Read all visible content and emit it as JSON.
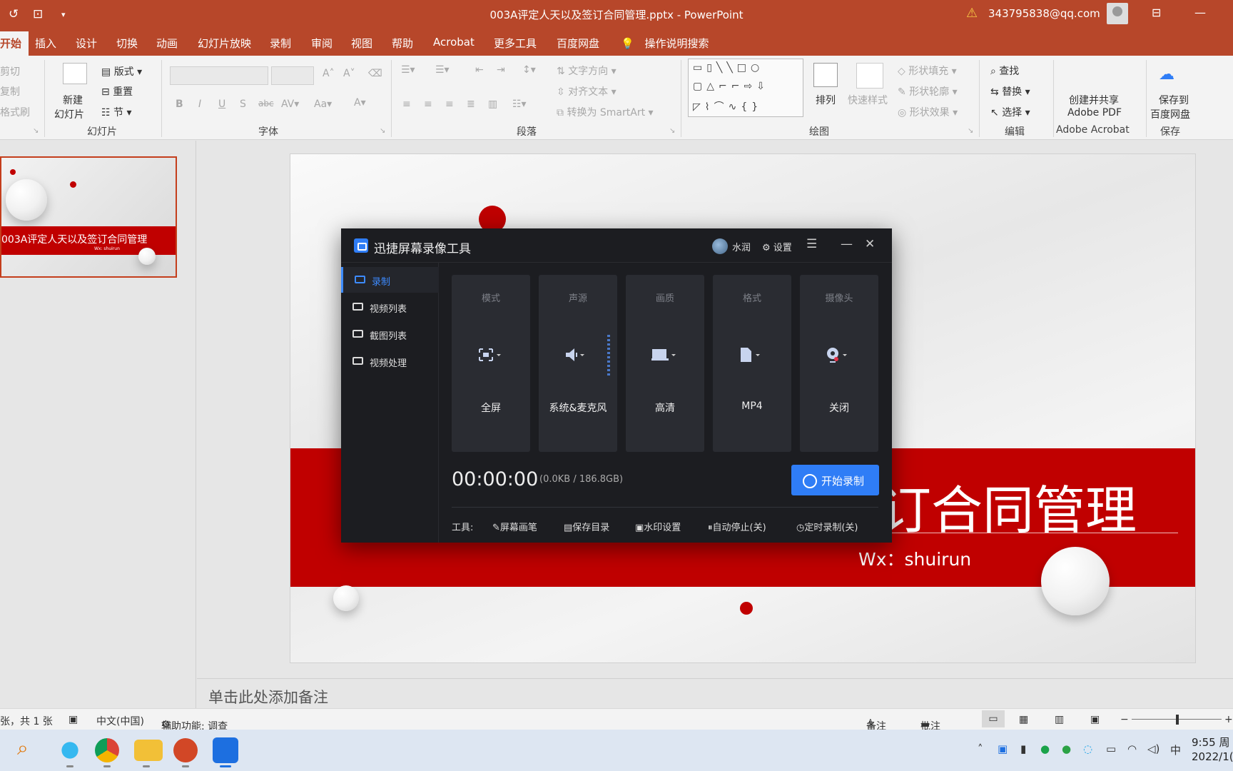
{
  "window": {
    "title": "003A评定人天以及签订合同管理.pptx - PowerPoint",
    "user_email": "343795838@qq.com"
  },
  "ribbon_tabs": [
    "开始",
    "插入",
    "设计",
    "切换",
    "动画",
    "幻灯片放映",
    "录制",
    "审阅",
    "视图",
    "帮助",
    "Acrobat",
    "更多工具",
    "百度网盘"
  ],
  "tell_me": "操作说明搜索",
  "ribbon": {
    "clipboard": {
      "cut": "剪切",
      "copy": "复制",
      "format_painter": "格式刷"
    },
    "slides": {
      "new_slide_line1": "新建",
      "new_slide_line2": "幻灯片",
      "layout": "版式",
      "reset": "重置",
      "section": "节",
      "group": "幻灯片"
    },
    "font": {
      "group": "字体"
    },
    "paragraph": {
      "text_direction": "文字方向",
      "align_text": "对齐文本",
      "smartart": "转换为 SmartArt",
      "group": "段落"
    },
    "drawing": {
      "arrange": "排列",
      "quick_styles": "快速样式",
      "shape_fill": "形状填充",
      "shape_outline": "形状轮廓",
      "shape_effects": "形状效果",
      "group": "绘图"
    },
    "editing": {
      "find": "查找",
      "replace": "替换",
      "select": "选择",
      "group": "编辑"
    },
    "acrobat": {
      "create_line1": "创建并共享",
      "create_line2": "Adobe PDF",
      "group": "Adobe Acrobat"
    },
    "save": {
      "save_line1": "保存到",
      "save_line2": "百度网盘",
      "group": "保存"
    }
  },
  "thumbnail": {
    "title": "003A评定人天以及签订合同管理",
    "sub": "Wx: shuirun"
  },
  "slide": {
    "title_visible": "订合同管理",
    "subtitle": "Wx：shuirun"
  },
  "notes_placeholder": "单击此处添加备注",
  "status": {
    "slide_count": "张，共 1 张",
    "language": "中文(中国)",
    "accessibility": "辅助功能: 调查",
    "notes": "备注",
    "comments": "批注"
  },
  "recorder": {
    "title": "迅捷屏幕录像工具",
    "user": "水润",
    "settings": "设置",
    "nav": [
      "录制",
      "视频列表",
      "截图列表",
      "视频处理"
    ],
    "cards": [
      {
        "title": "模式",
        "value": "全屏",
        "icon": "fullscreen-icon"
      },
      {
        "title": "声源",
        "value": "系统&麦克风",
        "icon": "speaker-icon"
      },
      {
        "title": "画质",
        "value": "高清",
        "icon": "monitor-icon"
      },
      {
        "title": "格式",
        "value": "MP4",
        "icon": "file-icon"
      },
      {
        "title": "摄像头",
        "value": "关闭",
        "icon": "camera-icon"
      }
    ],
    "timer": "00:00:00",
    "size": "(0.0KB / 186.8GB)",
    "start_button": "开始录制",
    "tools_label": "工具:",
    "tools": [
      "屏幕画笔",
      "保存目录",
      "水印设置",
      "自动停止(关)",
      "定时录制(关)"
    ]
  },
  "clock": {
    "time": "9:55 周",
    "date": "2022/1("
  },
  "colors": {
    "accent": "#b7472a",
    "slide_red": "#c00000",
    "recorder_blue": "#2f7df6"
  }
}
